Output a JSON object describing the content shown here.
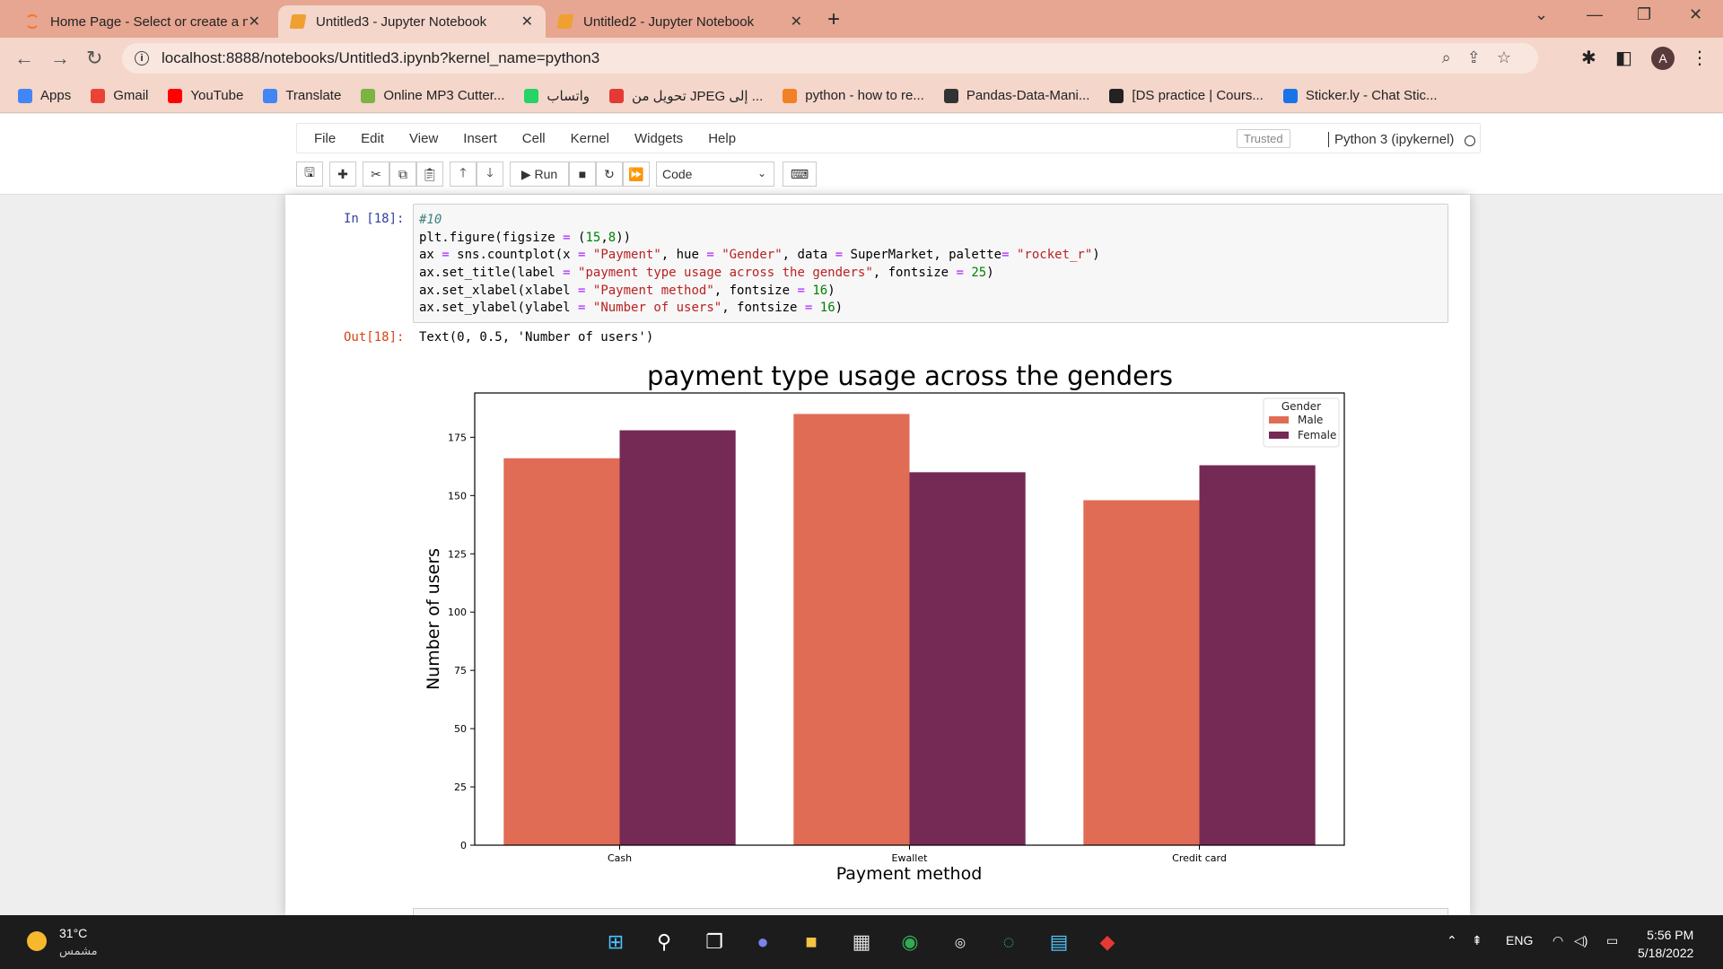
{
  "browser": {
    "tabs": [
      {
        "title": "Home Page - Select or create a n",
        "active": false
      },
      {
        "title": "Untitled3 - Jupyter Notebook",
        "active": true
      },
      {
        "title": "Untitled2 - Jupyter Notebook",
        "active": false
      }
    ],
    "url": "localhost:8888/notebooks/Untitled3.ipynb?kernel_name=python3",
    "avatar_letter": "A",
    "bookmarks": [
      {
        "label": "Apps",
        "icon": "apps-grid-icon",
        "color": "#4285f4"
      },
      {
        "label": "Gmail",
        "icon": "gmail-icon",
        "color": "#ea4335"
      },
      {
        "label": "YouTube",
        "icon": "youtube-icon",
        "color": "#ff0000"
      },
      {
        "label": "Translate",
        "icon": "translate-icon",
        "color": "#4285f4"
      },
      {
        "label": "Online MP3 Cutter...",
        "icon": "mp3-cutter-icon",
        "color": "#7cb342"
      },
      {
        "label": "واتساب",
        "icon": "whatsapp-icon",
        "color": "#25d366"
      },
      {
        "label": "تحويل من JPEG إلى ...",
        "icon": "pdf-convert-icon",
        "color": "#e53935"
      },
      {
        "label": "python - how to re...",
        "icon": "stackoverflow-icon",
        "color": "#f48024"
      },
      {
        "label": "Pandas-Data-Mani...",
        "icon": "github-icon",
        "color": "#333333"
      },
      {
        "label": "[DS practice | Cours...",
        "icon": "globe-icon",
        "color": "#222222"
      },
      {
        "label": "Sticker.ly - Chat Stic...",
        "icon": "stickerly-icon",
        "color": "#1a73e8"
      }
    ]
  },
  "jupyter": {
    "menu": [
      "File",
      "Edit",
      "View",
      "Insert",
      "Cell",
      "Kernel",
      "Widgets",
      "Help"
    ],
    "trusted": "Trusted",
    "kernel_name": "Python 3 (ipykernel)",
    "run_label": "Run",
    "cell_type": "Code"
  },
  "cell": {
    "in_prompt": "In [18]:",
    "out_prompt": "Out[18]:",
    "output_text": "Text(0, 0.5, 'Number of users')"
  },
  "chart_data": {
    "type": "bar",
    "title": "payment type usage across the genders",
    "xlabel": "Payment method",
    "ylabel": "Number of users",
    "categories": [
      "Cash",
      "Ewallet",
      "Credit card"
    ],
    "series": [
      {
        "name": "Male",
        "values": [
          166,
          185,
          148
        ],
        "color": "#e06c55"
      },
      {
        "name": "Female",
        "values": [
          178,
          160,
          163
        ],
        "color": "#752a55"
      }
    ],
    "yticks": [
      0,
      25,
      50,
      75,
      100,
      125,
      150,
      175
    ],
    "ylim": [
      0,
      194
    ],
    "legend_title": "Gender",
    "legend_position": "top-right",
    "grid": false
  },
  "taskbar": {
    "temperature": "31°C",
    "weather": "مشمس",
    "language": "ENG",
    "time": "5:56 PM",
    "date": "5/18/2022"
  }
}
